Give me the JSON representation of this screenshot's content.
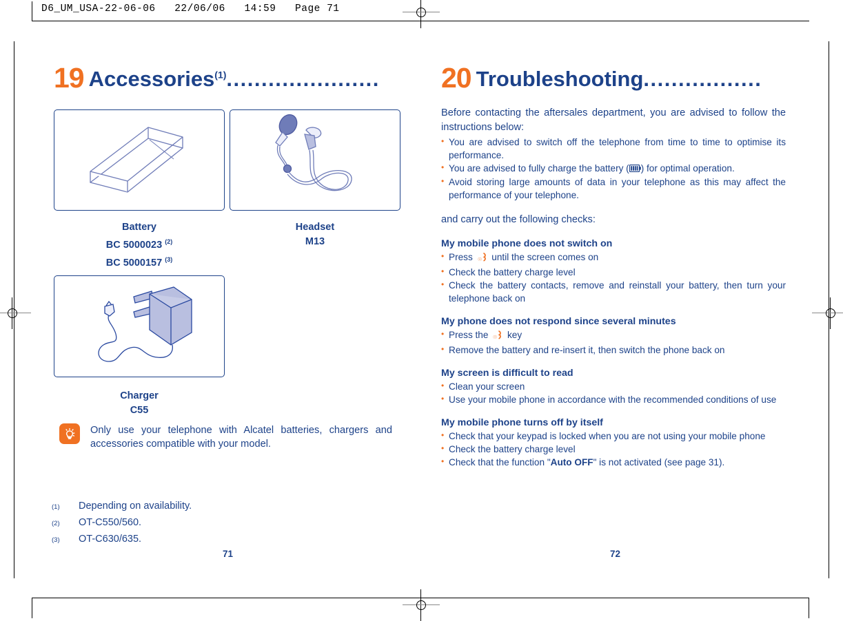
{
  "slug": {
    "text": "D6_UM_USA-22-06-06   22/06/06   14:59   Page 71"
  },
  "colors": {
    "brand_blue": "#1d4289",
    "accent_orange": "#f07122",
    "illustration_fill": "#b9bfe0"
  },
  "left_page": {
    "chapter_number": "19",
    "chapter_title": "Accessories",
    "chapter_superscript": "(1)",
    "chapter_leader": "......................",
    "products": [
      {
        "icon": "battery-illustration",
        "caption_lines": [
          {
            "text": "Battery",
            "sup": ""
          },
          {
            "text": "BC 5000023",
            "sup": "(2)"
          },
          {
            "text": "BC 5000157",
            "sup": "(3)"
          }
        ]
      },
      {
        "icon": "headset-illustration",
        "caption_lines": [
          {
            "text": "Headset",
            "sup": ""
          },
          {
            "text": "M13",
            "sup": ""
          }
        ]
      },
      {
        "icon": "charger-illustration",
        "caption_lines": [
          {
            "text": "Charger",
            "sup": ""
          },
          {
            "text": "C55",
            "sup": ""
          }
        ]
      }
    ],
    "note": {
      "icon": "lightbulb-tip-icon",
      "text": "Only use your telephone with Alcatel batteries, chargers and accessories compatible with your model."
    },
    "footnotes": [
      {
        "mark": "(1)",
        "text": "Depending on availability."
      },
      {
        "mark": "(2)",
        "text": "OT-C550/560."
      },
      {
        "mark": "(3)",
        "text": "OT-C630/635."
      }
    ],
    "page_number": "71"
  },
  "right_page": {
    "chapter_number": "20",
    "chapter_title": "Troubleshooting",
    "chapter_leader": ".................",
    "intro": "Before contacting the aftersales department, you are advised to follow the instructions below:",
    "intro_bullets": [
      {
        "pre": "You are advised to switch off the telephone from time to time to optimise its performance.",
        "post": ""
      },
      {
        "pre": "You are advised to fully charge the battery (",
        "icon": "battery-level-icon",
        "post": ") for optimal operation."
      },
      {
        "pre": "Avoid storing large amounts of data in your telephone as this may affect the performance of your telephone.",
        "post": ""
      }
    ],
    "checks_lead": "and carry out the following checks:",
    "sections": [
      {
        "heading": "My mobile phone does not switch on",
        "items": [
          {
            "pre": "Press ",
            "icon": "power-key-icon",
            "post": " until the screen comes on"
          },
          {
            "pre": "Check the battery charge level",
            "post": ""
          },
          {
            "pre": "Check the battery contacts, remove and reinstall your battery, then turn your telephone back on",
            "post": ""
          }
        ]
      },
      {
        "heading": "My phone does not respond since several minutes",
        "items": [
          {
            "pre": "Press the ",
            "icon": "power-key-icon",
            "post": " key"
          },
          {
            "pre": "Remove the battery and re-insert it, then switch the phone back on",
            "post": ""
          }
        ]
      },
      {
        "heading": "My screen is difficult to read",
        "items": [
          {
            "pre": "Clean your screen",
            "post": ""
          },
          {
            "pre": "Use your mobile phone in accordance with the recommended conditions of use",
            "post": ""
          }
        ]
      },
      {
        "heading": "My mobile phone turns off by itself",
        "items": [
          {
            "pre": "Check that your keypad is locked when you are not using your mobile phone",
            "post": ""
          },
          {
            "pre": "Check the battery charge level",
            "post": ""
          },
          {
            "pre": "Check that the function \"",
            "bold": "Auto OFF",
            "post": "\" is not activated (see page 31)."
          }
        ]
      }
    ],
    "page_number": "72"
  }
}
